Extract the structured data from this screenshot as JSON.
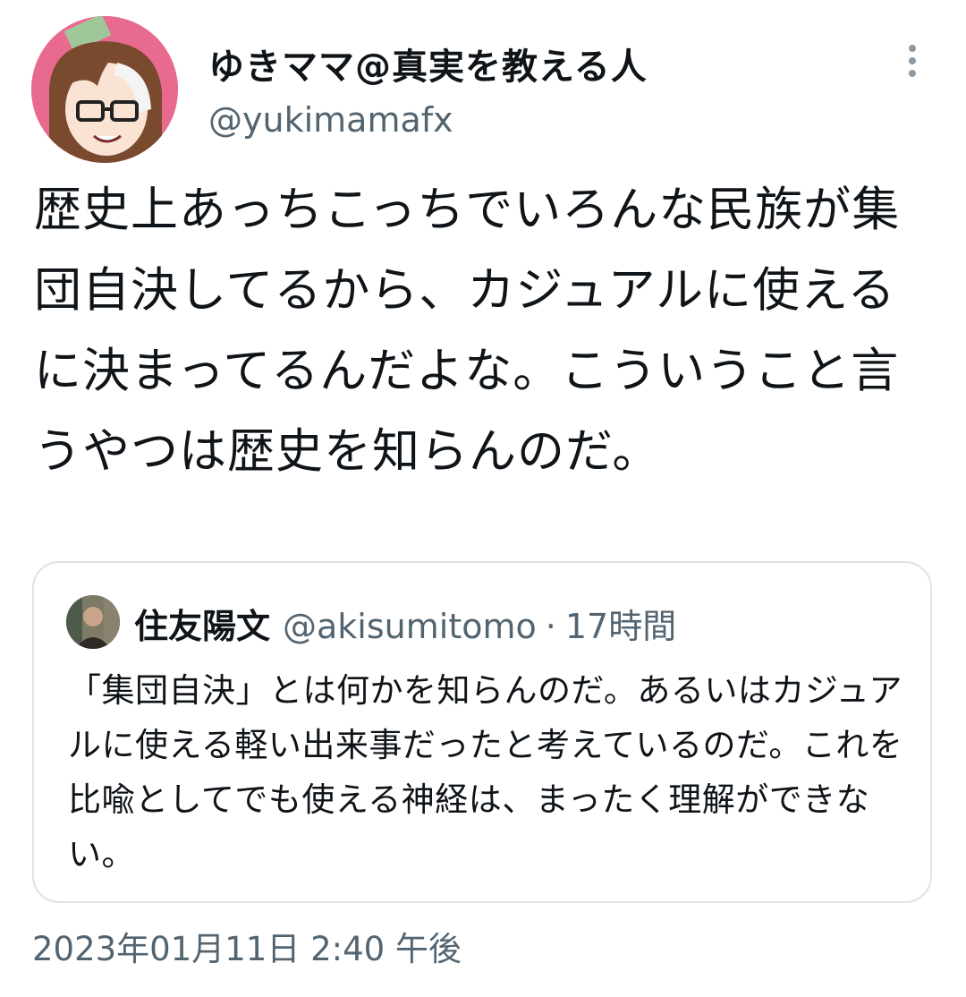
{
  "author": {
    "display_name": "ゆきママ@真実を教える人",
    "handle": "@yukimamafx"
  },
  "more_icon": "ellipsis-vertical-icon",
  "tweet": {
    "text": "歴史上あっちこっちでいろんな民族が集団自決してるから、カジュアルに使えるに決まってるんだよな。こういうこと言うやつは歴史を知らんのだ。"
  },
  "quote": {
    "display_name": "住友陽文",
    "handle": "@akisumitomo",
    "separator": "·",
    "time_ago": "17時間",
    "text": "「集団自決」とは何かを知らんのだ。あるいはカジュアルに使える軽い出来事だったと考えているのだ。これを比喩としてでも使える神経は、まったく理解ができない。"
  },
  "timestamp": "2023年01月11日 2:40 午後",
  "colors": {
    "text": "#0f1419",
    "secondary": "#536471",
    "border": "#dde3e8",
    "avatar_bg": "#e86a8e"
  }
}
